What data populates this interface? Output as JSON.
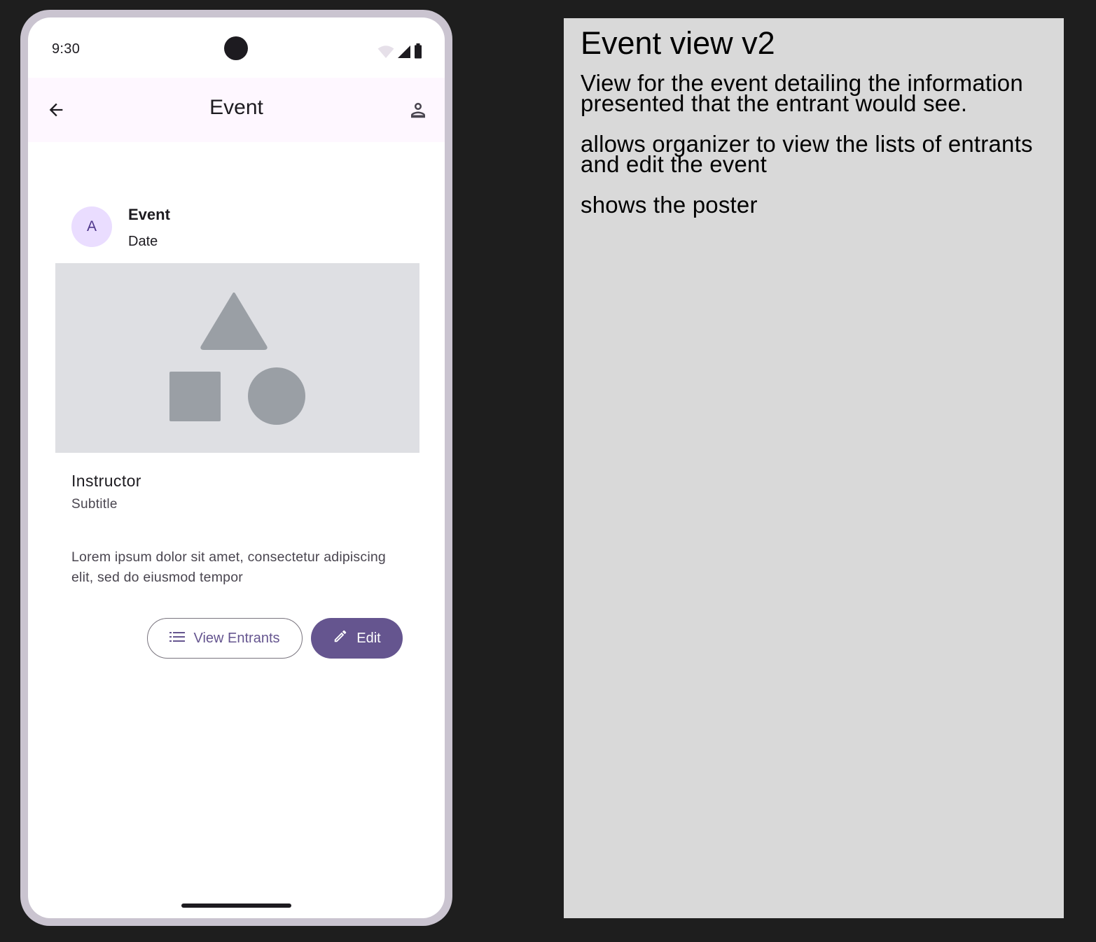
{
  "status_bar": {
    "time": "9:30"
  },
  "app_bar": {
    "title": "Event",
    "back_icon": "arrow-left-icon",
    "account_icon": "person-outline-icon"
  },
  "card": {
    "avatar_letter": "A",
    "header_title": "Event",
    "header_subtitle": "Date",
    "media_placeholder_icons": [
      "triangle",
      "square",
      "circle"
    ],
    "headline": "Instructor",
    "subhead": "Subtitle",
    "supporting_text": "Lorem ipsum dolor sit amet, consectetur adipiscing elit, sed do eiusmod tempor"
  },
  "actions": {
    "view_entrants_label": "View Entrants",
    "view_entrants_icon": "list-icon",
    "edit_label": "Edit",
    "edit_icon": "pencil-icon"
  },
  "note": {
    "title": "Event view v2",
    "paragraphs": [
      "View for the event detailing the information presented that the entrant would see.",
      "allows organizer to view the lists of entrants and edit the event",
      "shows the poster"
    ]
  },
  "colors": {
    "background": "#1e1e1e",
    "phone_frame": "#cac4d0",
    "app_bar": "#fef7ff",
    "avatar_bg": "#eaddff",
    "primary": "#65558f",
    "media_bg": "#dedfe3",
    "media_shapes": "#9a9fa5",
    "note_bg": "#d9d9d9"
  }
}
